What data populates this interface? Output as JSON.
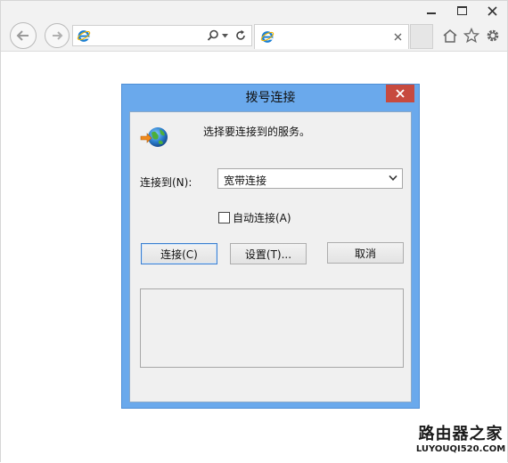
{
  "browser": {
    "address_value": "",
    "tab_title": "",
    "icons": {
      "back": "back-arrow-icon",
      "forward": "forward-arrow-icon",
      "ie": "ie-logo-icon",
      "search": "search-icon",
      "refresh": "refresh-icon",
      "close_tab": "close-icon",
      "home": "home-icon",
      "favorites": "star-icon",
      "tools": "gear-icon"
    }
  },
  "dialog": {
    "title": "拨号连接",
    "description": "选择要连接到的服务。",
    "connect_to_label": "连接到(N):",
    "connection_selected": "宽带连接",
    "auto_connect_label": "自动连接(A)",
    "auto_connect_checked": false,
    "buttons": {
      "connect": "连接(C)",
      "settings": "设置(T)...",
      "cancel": "取消"
    },
    "colors": {
      "frame": "#6aa9ec",
      "close_button": "#c74a3f",
      "client": "#f0f0f0"
    }
  },
  "watermark": {
    "line1": "路由器之家",
    "line2": "LUYOUQI520.COM"
  }
}
